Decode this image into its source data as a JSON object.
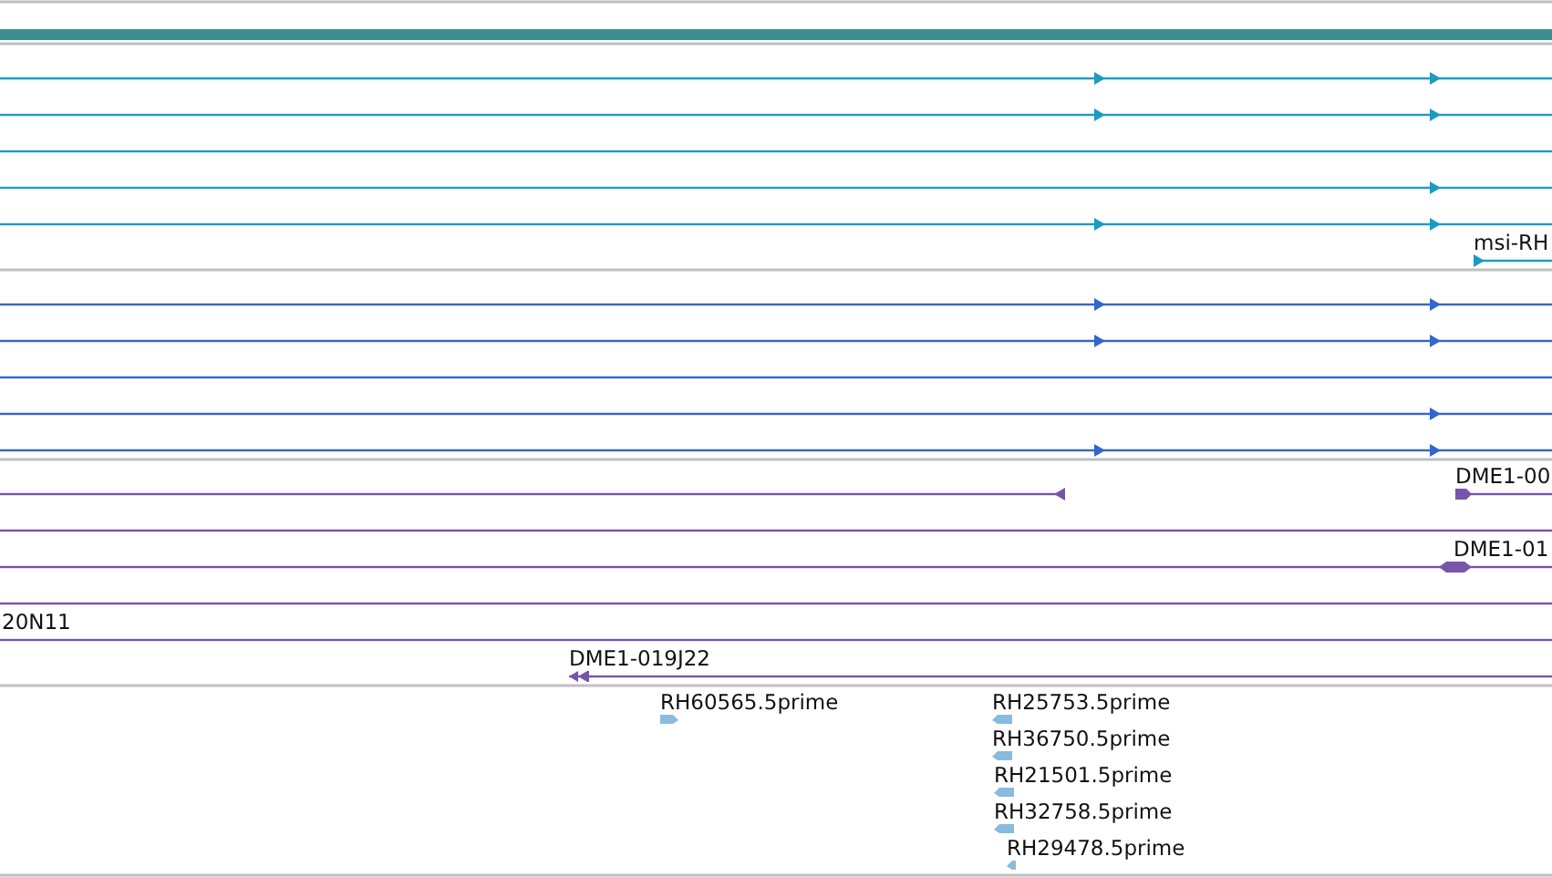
{
  "tracks": [
    {
      "kind": "alignment",
      "color": "#1a9bc4",
      "rows": [
        {
          "features": [
            {
              "kind": "arrow",
              "reverse": false
            },
            {
              "kind": "arrow",
              "reverse": false
            }
          ]
        },
        {
          "features": [
            {
              "kind": "arrow",
              "reverse": false
            },
            {
              "kind": "arrow",
              "reverse": false
            }
          ]
        },
        {
          "features": []
        },
        {
          "features": [
            {
              "kind": "arrow",
              "reverse": false
            }
          ]
        },
        {
          "features": [
            {
              "kind": "arrow",
              "reverse": false
            },
            {
              "kind": "arrow",
              "reverse": false
            }
          ]
        },
        {
          "features": [
            {
              "label": "msi-RH",
              "kind": "arrow",
              "reverse": false
            }
          ]
        }
      ]
    },
    {
      "kind": "alignment",
      "color": "#3366cc",
      "rows": [
        {
          "features": [
            {
              "kind": "arrow",
              "reverse": false
            },
            {
              "kind": "arrow",
              "reverse": false
            }
          ]
        },
        {
          "features": [
            {
              "kind": "arrow",
              "reverse": false
            },
            {
              "kind": "arrow",
              "reverse": false
            }
          ]
        },
        {
          "features": []
        },
        {
          "features": [
            {
              "kind": "arrow",
              "reverse": false
            }
          ]
        },
        {
          "features": [
            {
              "kind": "arrow",
              "reverse": false
            },
            {
              "kind": "arrow",
              "reverse": false
            }
          ]
        }
      ]
    },
    {
      "kind": "clone",
      "color": "#7755aa",
      "rows": [
        {
          "features": [
            {
              "kind": "arrow",
              "reverse": true
            },
            {
              "label": "DME1-00",
              "kind": "arrow",
              "reverse": false
            }
          ]
        },
        {
          "features": []
        },
        {
          "features": [
            {
              "label": "DME1-01",
              "kind": "double"
            }
          ]
        },
        {
          "features": []
        },
        {
          "features": [
            {
              "label": "20N11",
              "kind": "none"
            }
          ]
        },
        {
          "features": [
            {
              "label": "DME1-019J22",
              "kind": "arrow",
              "reverse": true
            }
          ]
        }
      ]
    },
    {
      "kind": "est",
      "color": "#88bbdd",
      "rows": [
        {
          "features": [
            {
              "label": "RH60565.5prime",
              "kind": "arrow",
              "reverse": false
            },
            {
              "label": "RH25753.5prime",
              "kind": "arrow",
              "reverse": true
            }
          ]
        },
        {
          "features": [
            {
              "label": "RH36750.5prime",
              "kind": "arrow",
              "reverse": true
            }
          ]
        },
        {
          "features": [
            {
              "label": "RH21501.5prime",
              "kind": "arrow",
              "reverse": true
            }
          ]
        },
        {
          "features": [
            {
              "label": "RH32758.5prime",
              "kind": "arrow",
              "reverse": true
            }
          ]
        },
        {
          "features": [
            {
              "label": "RH29478.5prime",
              "kind": "arrow",
              "reverse": true
            }
          ]
        }
      ]
    }
  ]
}
